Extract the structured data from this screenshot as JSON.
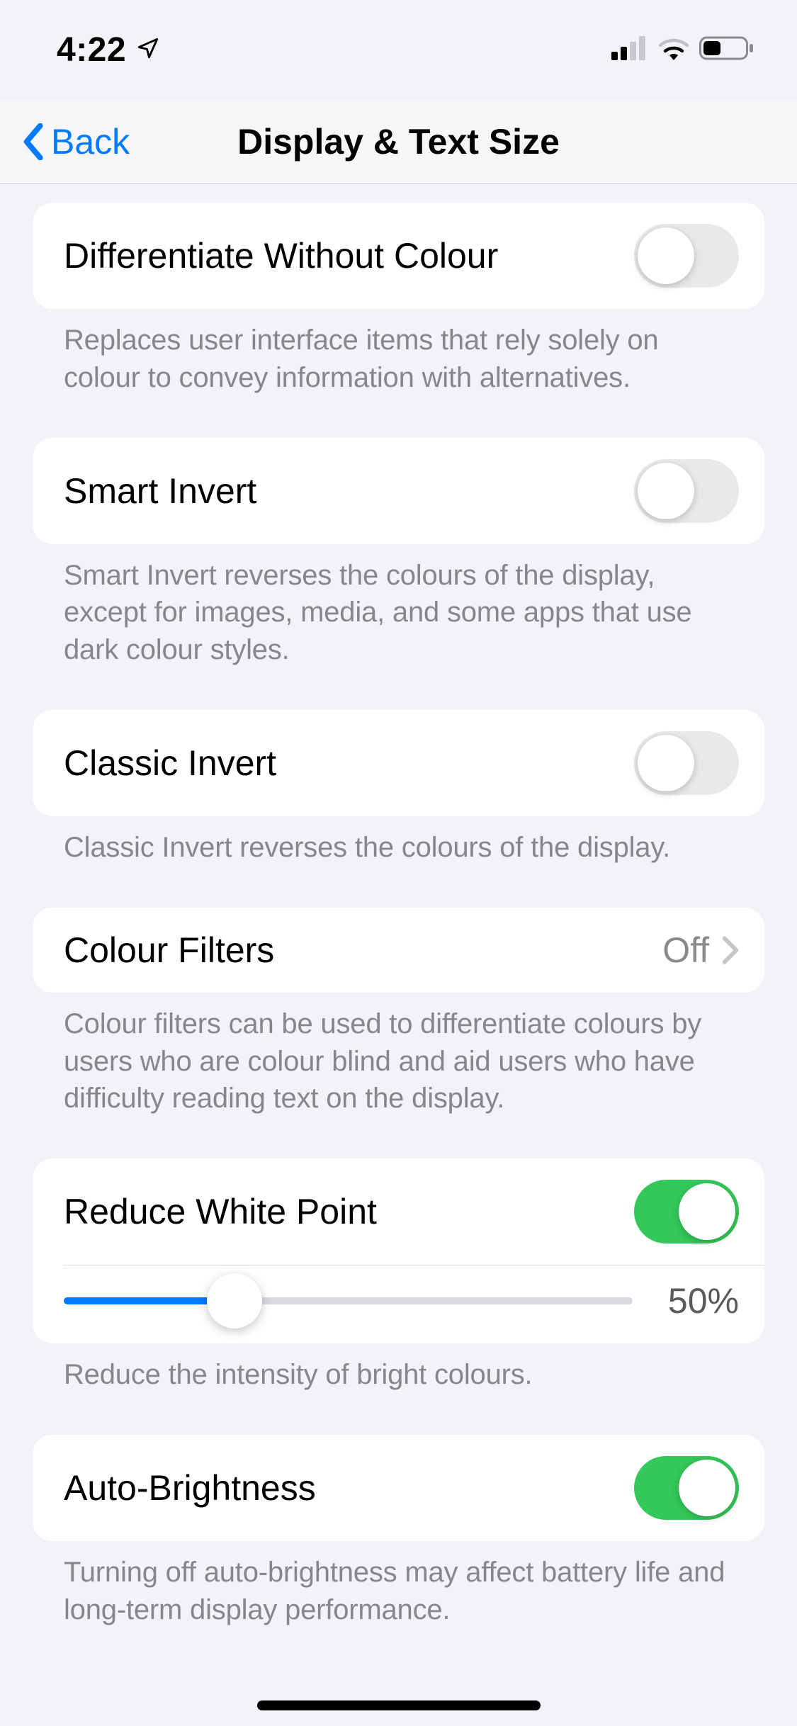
{
  "status": {
    "time": "4:22"
  },
  "nav": {
    "back_label": "Back",
    "title": "Display & Text Size"
  },
  "settings": {
    "differentiate": {
      "label": "Differentiate Without Colour",
      "on": false,
      "footer": "Replaces user interface items that rely solely on colour to convey information with alternatives."
    },
    "smart_invert": {
      "label": "Smart Invert",
      "on": false,
      "footer": "Smart Invert reverses the colours of the display, except for images, media, and some apps that use dark colour styles."
    },
    "classic_invert": {
      "label": "Classic Invert",
      "on": false,
      "footer": "Classic Invert reverses the colours of the display."
    },
    "colour_filters": {
      "label": "Colour Filters",
      "value": "Off",
      "footer": "Colour filters can be used to differentiate colours by users who are colour blind and aid users who have difficulty reading text on the display."
    },
    "reduce_white_point": {
      "label": "Reduce White Point",
      "on": true,
      "slider_percent": 50,
      "slider_fill_percent": 30,
      "slider_value_label": "50%",
      "footer": "Reduce the intensity of bright colours."
    },
    "auto_brightness": {
      "label": "Auto-Brightness",
      "on": true,
      "footer": "Turning off auto-brightness may affect battery life and long-term display performance."
    }
  },
  "colors": {
    "accent_blue": "#007aff",
    "toggle_green": "#34c759",
    "secondary_text": "#86868b"
  }
}
